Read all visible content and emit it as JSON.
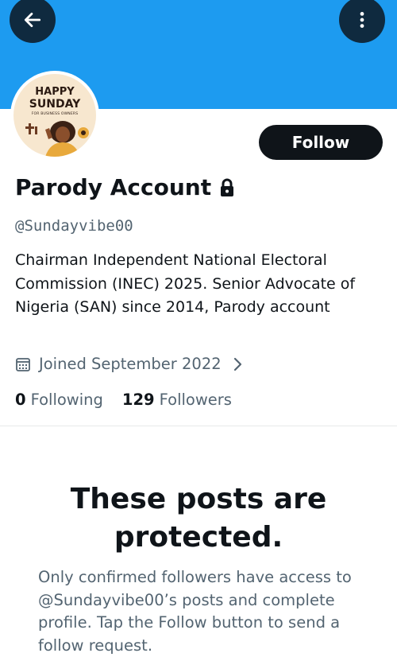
{
  "header": {
    "back_icon": "arrow-left-icon",
    "more_icon": "more-vertical-icon",
    "banner_color": "#1d9bf0"
  },
  "avatar": {
    "line1": "HAPPY",
    "line2": "SUNDAY",
    "line3": "FOR BUSINESS OWNERS"
  },
  "profile": {
    "follow_label": "Follow",
    "display_name": "Parody Account",
    "lock_icon": "lock-icon",
    "handle": "@Sundayvibe00",
    "bio": "Chairman Independent National Electoral Commission (INEC) 2025. Senior Advocate of Nigeria (SAN) since 2014, Parody account",
    "joined": "Joined September 2022",
    "calendar_icon": "calendar-icon",
    "following_count": "0",
    "following_label": "Following",
    "followers_count": "129",
    "followers_label": "Followers"
  },
  "protected": {
    "title_line1": "These posts are",
    "title_line2": "protected.",
    "body": "Only confirmed followers have access to @Sundayvibe00’s posts and complete profile. Tap the Follow button to send a follow request."
  },
  "colors": {
    "accent": "#1d9bf0",
    "text": "#0f1419",
    "muted": "#536471"
  }
}
